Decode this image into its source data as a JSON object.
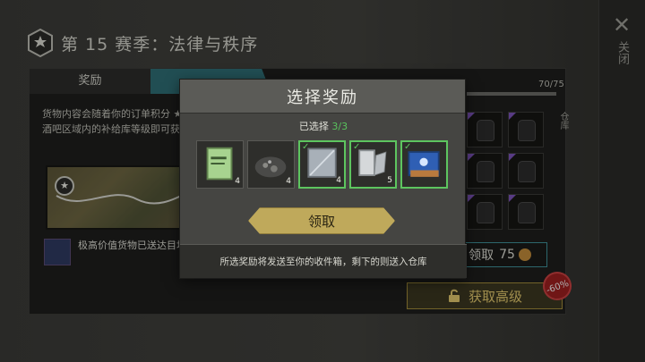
{
  "header": {
    "season_title": "第 15 赛季：法律与秩序",
    "close_label": "关闭"
  },
  "tabs": [
    {
      "label": "奖励"
    },
    {
      "label": "…"
    }
  ],
  "left_panel": {
    "description": "货物内容会随着你的订单积分 ★ 酒吧区域内的补给库等级即可获",
    "note": "极高价值货物已送达目地！"
  },
  "right_panel": {
    "progress": "70/75",
    "storage_label": "仓库",
    "claim_label": "领取",
    "claim_cost": "75",
    "premium_label": "获取高级",
    "discount": "-60%"
  },
  "modal": {
    "title": "选择奖励",
    "selected_prefix": "已选择",
    "selected_count": "3/3",
    "items": [
      {
        "name": "notebook-icon",
        "qty": "4",
        "selected": false
      },
      {
        "name": "gravel-icon",
        "qty": "4",
        "selected": false
      },
      {
        "name": "metal-plate-icon",
        "qty": "4",
        "selected": true
      },
      {
        "name": "scrap-metal-icon",
        "qty": "5",
        "selected": true
      },
      {
        "name": "blue-box-icon",
        "qty": "",
        "selected": true
      }
    ],
    "claim_button": "领取",
    "footer_text": "所选奖励将发送至你的收件箱，剩下的则送入仓库"
  }
}
